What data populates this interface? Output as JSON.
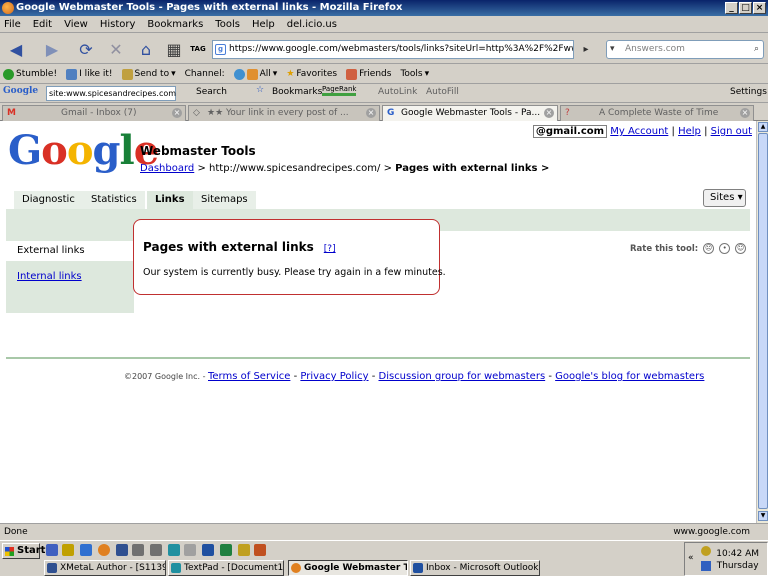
{
  "window": {
    "title": "Google Webmaster Tools - Pages with external links - Mozilla Firefox"
  },
  "menu": [
    "File",
    "Edit",
    "View",
    "History",
    "Bookmarks",
    "Tools",
    "Help",
    "del.icio.us"
  ],
  "navbar": {
    "url": "https://www.google.com/webmasters/tools/links?siteUrl=http%3A%2F%2Fwww.spice",
    "search_placeholder": "Answers.com",
    "tag_label": "TAG"
  },
  "toolbar2": {
    "stumble": "Stumble!",
    "like": "I like it!",
    "send": "Send to",
    "channel": "Channel:",
    "all": "All",
    "favorites": "Favorites",
    "friends": "Friends",
    "tools": "Tools"
  },
  "toolbar3": {
    "google": "Google",
    "search_value": "site:www.spicesandrecipes.com",
    "search": "Search",
    "bookmarks": "Bookmarks",
    "pagerank": "PageRank",
    "autolink": "AutoLink",
    "autofill": "AutoFill",
    "settings": "Settings"
  },
  "tabs": [
    {
      "label": "Gmail - Inbox (7)"
    },
    {
      "label": "★★ Your link in every post of ..."
    },
    {
      "label": "Google Webmaster Tools - Pa..."
    },
    {
      "label": "A Complete Waste of Time"
    }
  ],
  "page": {
    "logo": [
      "G",
      "o",
      "o",
      "g",
      "l",
      "e"
    ],
    "product_name": "Webmaster Tools",
    "breadcrumb_link": "Dashboard",
    "breadcrumb_sep1": " > ",
    "breadcrumb_site": "http://www.spicesandrecipes.com/",
    "breadcrumb_sep2": " > ",
    "breadcrumb_current": "Pages with external links >",
    "account_email": "@gmail.com",
    "my_account": "My Account",
    "sep": " | ",
    "help": "Help",
    "sign_out": "Sign out",
    "nav_tabs": [
      "Diagnostic",
      "Statistics",
      "Links",
      "Sitemaps"
    ],
    "sites": "Sites",
    "side_external": "External links",
    "side_internal": "Internal links",
    "box_title": "Pages with external links",
    "box_help": "[?]",
    "box_message": "Our system is currently busy. Please try again in a few minutes.",
    "rate": "Rate this tool:",
    "copyright": "©2007 Google Inc. - ",
    "footer_links": [
      "Terms of Service",
      "Privacy Policy",
      "Discussion group for webmasters",
      "Google's blog for webmasters"
    ],
    "footer_sep": " - "
  },
  "status": {
    "left": "Done",
    "right": "www.google.com"
  },
  "taskbar": {
    "start": "Start",
    "tasks": [
      "XMetaL Author - [S1139...",
      "TextPad - [Document1 *]",
      "Google Webmaster T...",
      "Inbox - Microsoft Outlook"
    ],
    "time": "10:42 AM",
    "day": "Thursday"
  }
}
